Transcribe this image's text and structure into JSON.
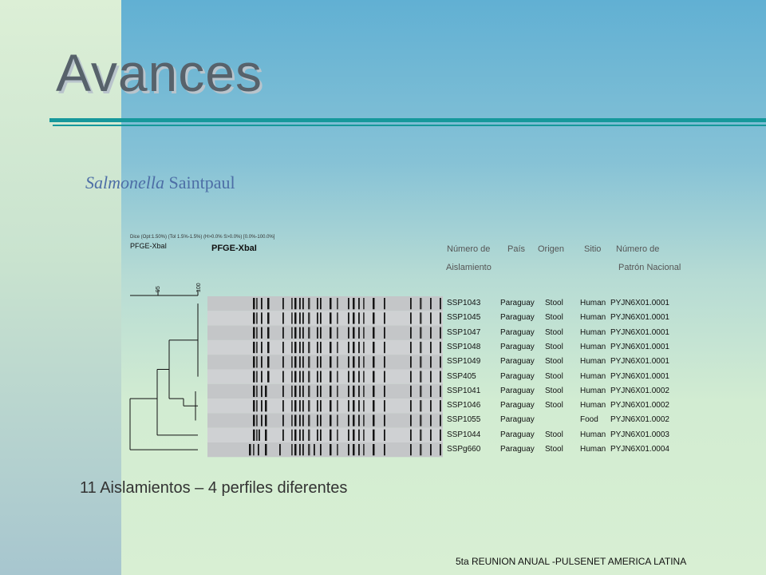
{
  "slide": {
    "title": "Avances",
    "subtitle_italic": "Salmonella",
    "subtitle_rest": " Saintpaul",
    "summary": "11  Aislamientos – 4 perfiles diferentes",
    "conference": "5ta REUNION ANUAL -PULSENET AMERICA LATINA"
  },
  "figure": {
    "header_line": "Dice (Opt:1.50%) (Tol 1.5%-1.5%) (H>0.0% S>0.0%) [0.0%-100.0%]",
    "gel_label_small": "PFGE-XbaI",
    "gel_label_big": "PFGE-XbaI",
    "column_headers": {
      "numero_de": "Número de",
      "aislamiento": "Aislamiento",
      "pais": "País",
      "origen": "Origen",
      "sitio": "Sitio",
      "numero_de_2": "Número de",
      "patron_nacional": "Patrón Nacional"
    },
    "rows": [
      {
        "id": "SSP1043",
        "country": "Paraguay",
        "origin": "Stool",
        "site": "Human",
        "pattern": "PYJN6X01.0001"
      },
      {
        "id": "SSP1045",
        "country": "Paraguay",
        "origin": "Stool",
        "site": "Human",
        "pattern": "PYJN6X01.0001"
      },
      {
        "id": "SSP1047",
        "country": "Paraguay",
        "origin": "Stool",
        "site": "Human",
        "pattern": "PYJN6X01.0001"
      },
      {
        "id": "SSP1048",
        "country": "Paraguay",
        "origin": "Stool",
        "site": "Human",
        "pattern": "PYJN6X01.0001"
      },
      {
        "id": "SSP1049",
        "country": "Paraguay",
        "origin": "Stool",
        "site": "Human",
        "pattern": "PYJN6X01.0001"
      },
      {
        "id": "SSP405",
        "country": "Paraguay",
        "origin": "Stool",
        "site": "Human",
        "pattern": "PYJN6X01.0001"
      },
      {
        "id": "SSP1041",
        "country": "Paraguay",
        "origin": "Stool",
        "site": "Human",
        "pattern": "PYJN6X01.0002"
      },
      {
        "id": "SSP1046",
        "country": "Paraguay",
        "origin": "Stool",
        "site": "Human",
        "pattern": "PYJN6X01.0002"
      },
      {
        "id": "SSP1055",
        "country": "Paraguay",
        "origin": "",
        "site": "Food",
        "pattern": "PYJN6X01.0002"
      },
      {
        "id": "SSP1044",
        "country": "Paraguay",
        "origin": "Stool",
        "site": "Human",
        "pattern": "PYJN6X01.0003"
      },
      {
        "id": "SSPg660",
        "country": "Paraguay",
        "origin": "Stool",
        "site": "Human",
        "pattern": "PYJN6X01.0004"
      }
    ],
    "scale_ticks": [
      "95",
      "100"
    ]
  },
  "colors": {
    "accent_rule": "#16989b",
    "title": "#57626b",
    "subtitle": "#4d6ea6"
  }
}
